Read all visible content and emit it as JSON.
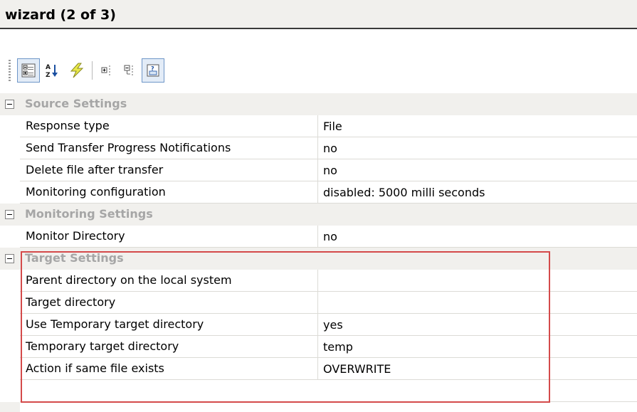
{
  "window": {
    "title": "wizard (2 of 3)"
  },
  "toolbar": {
    "buttons": [
      {
        "name": "categorized-view-button",
        "icon": "categorized-icon",
        "active": true
      },
      {
        "name": "alphabetical-sort-button",
        "icon": "sort-az-icon",
        "active": false
      },
      {
        "name": "lightning-button",
        "icon": "lightning-icon",
        "active": false
      },
      {
        "name": "expand-button",
        "icon": "expand-icon",
        "active": false
      },
      {
        "name": "collapse-button",
        "icon": "collapse-icon",
        "active": false
      },
      {
        "name": "property-pages-button",
        "icon": "property-pages-icon",
        "active": true
      }
    ]
  },
  "sections": [
    {
      "label": "Source Settings",
      "properties": [
        {
          "name": "Response type",
          "value": "File"
        },
        {
          "name": "Send Transfer Progress Notifications",
          "value": "no"
        },
        {
          "name": "Delete file after transfer",
          "value": "no"
        },
        {
          "name": "Monitoring configuration",
          "value": "disabled: 5000 milli seconds"
        }
      ]
    },
    {
      "label": "Monitoring Settings",
      "properties": [
        {
          "name": "Monitor Directory",
          "value": "no"
        }
      ]
    },
    {
      "label": "Target Settings",
      "properties": [
        {
          "name": "Parent directory on the local system",
          "value": ""
        },
        {
          "name": "Target directory",
          "value": ""
        },
        {
          "name": "Use Temporary target directory",
          "value": "yes"
        },
        {
          "name": "Temporary target directory",
          "value": "temp"
        },
        {
          "name": "Action if same file exists",
          "value": "OVERWRITE"
        }
      ]
    }
  ],
  "colors": {
    "category_text": "#a6a6a6",
    "highlight_border": "#d44a4a",
    "active_button_border": "#6e96c8"
  }
}
